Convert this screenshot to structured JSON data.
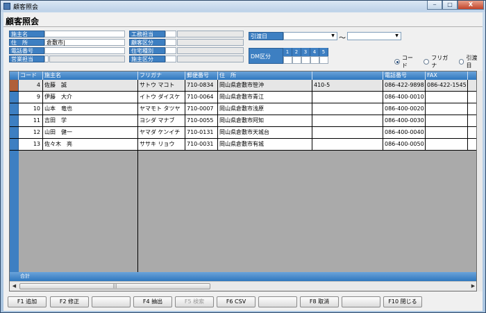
{
  "window": {
    "title": "顧客照会",
    "controls": [
      "‒",
      "□",
      "X"
    ]
  },
  "page_title": "顧客照会",
  "form": {
    "left": [
      {
        "label": "施主名",
        "value": "",
        "gray": false
      },
      {
        "label": "住　所",
        "value": "倉敷市|",
        "gray": false
      },
      {
        "label": "電話番号",
        "value": "",
        "gray": false
      },
      {
        "label": "営業担当",
        "value": "",
        "gray": true
      }
    ],
    "middle": [
      {
        "label": "工務担当",
        "value": ""
      },
      {
        "label": "顧客区分",
        "value": ""
      },
      {
        "label": "住宅種別",
        "value": ""
      },
      {
        "label": "施主区分",
        "value": ""
      }
    ],
    "hikiwatashi_label": "引渡日",
    "date_from": "",
    "tilde": "～",
    "date_to": "",
    "dm_label": "DM区分",
    "dm_numbers": [
      "1",
      "2",
      "3",
      "4",
      "5"
    ]
  },
  "sort_options": [
    {
      "label": "コード",
      "selected": true
    },
    {
      "label": "フリガナ",
      "selected": false
    },
    {
      "label": "引渡日",
      "selected": false
    }
  ],
  "grid": {
    "columns": [
      "コード",
      "施主名",
      "フリガナ",
      "郵便番号",
      "住　所",
      "",
      "電話番号",
      "FAX",
      ""
    ],
    "rows": [
      {
        "code": "4",
        "name": "佐藤　誠",
        "kana": "サトウ マコト",
        "zip": "710-0834",
        "addr1": "岡山県倉敷市笹沖",
        "addr2": "410-5",
        "tel": "086-422-9898",
        "fax": "086-422-1545",
        "selected": true
      },
      {
        "code": "9",
        "name": "伊藤　大介",
        "kana": "イトウ ダイスケ",
        "zip": "710-0064",
        "addr1": "岡山県倉敷市青江",
        "addr2": "",
        "tel": "086-400-0010",
        "fax": "",
        "selected": false
      },
      {
        "code": "10",
        "name": "山本　竜也",
        "kana": "ヤマモト タツヤ",
        "zip": "710-0007",
        "addr1": "岡山県倉敷市浅原",
        "addr2": "",
        "tel": "086-400-0020",
        "fax": "",
        "selected": false
      },
      {
        "code": "11",
        "name": "吉田　学",
        "kana": "ヨシダ マナブ",
        "zip": "710-0055",
        "addr1": "岡山県倉敷市阿知",
        "addr2": "",
        "tel": "086-400-0030",
        "fax": "",
        "selected": false
      },
      {
        "code": "12",
        "name": "山田　健一",
        "kana": "ヤマダ ケンイチ",
        "zip": "710-0131",
        "addr1": "岡山県倉敷市天城台",
        "addr2": "",
        "tel": "086-400-0040",
        "fax": "",
        "selected": false
      },
      {
        "code": "13",
        "name": "佐々木　亮",
        "kana": "ササキ リョウ",
        "zip": "710-0031",
        "addr1": "岡山県倉敷市有城",
        "addr2": "",
        "tel": "086-400-0050",
        "fax": "",
        "selected": false
      }
    ],
    "footer_label": "合計"
  },
  "function_keys": [
    {
      "label": "F1 追加",
      "enabled": true
    },
    {
      "label": "F2 修正",
      "enabled": true
    },
    {
      "label": "",
      "enabled": true
    },
    {
      "label": "F4 抽出",
      "enabled": true
    },
    {
      "label": "F5 検索",
      "enabled": false
    },
    {
      "label": "F6 CSV",
      "enabled": true
    },
    {
      "label": "",
      "enabled": true
    },
    {
      "label": "F8 取消",
      "enabled": true
    },
    {
      "label": "",
      "enabled": true
    },
    {
      "label": "F10 閉じる",
      "enabled": true
    }
  ]
}
